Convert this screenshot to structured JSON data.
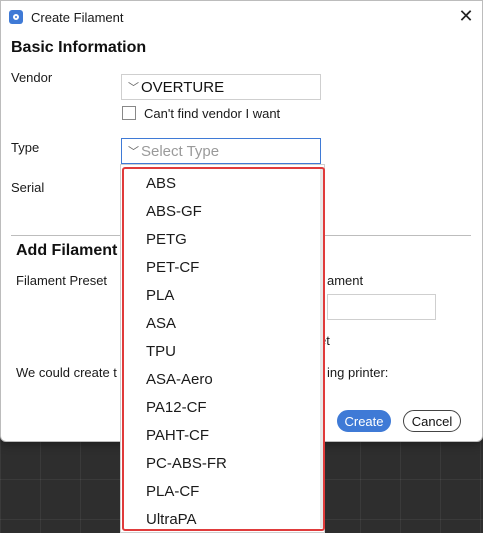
{
  "window": {
    "title": "Create Filament",
    "close_glyph": "✕"
  },
  "basic_info": {
    "heading": "Basic Information",
    "vendor_label": "Vendor",
    "vendor_value": "OVERTURE",
    "cant_find_label": "Can't find vendor I want",
    "type_label": "Type",
    "type_placeholder": "Select Type",
    "serial_label": "Serial"
  },
  "add_filament": {
    "heading_visible": "Add Filament",
    "preset_label": "Filament Preset",
    "right_label_fragment": "ament",
    "right_fragment_2": "et",
    "create_text_start": "We could create t",
    "create_text_end": "ing printer:"
  },
  "buttons": {
    "create": "Create",
    "cancel": "Cancel"
  },
  "type_dropdown": {
    "options": [
      "ABS",
      "ABS-GF",
      "PETG",
      "PET-CF",
      "PLA",
      "ASA",
      "TPU",
      "ASA-Aero",
      "PA12-CF",
      "PAHT-CF",
      "PC-ABS-FR",
      "PLA-CF",
      "UltraPA"
    ]
  },
  "colors": {
    "accent": "#3f7ad6",
    "highlight": "#e03b3b"
  }
}
